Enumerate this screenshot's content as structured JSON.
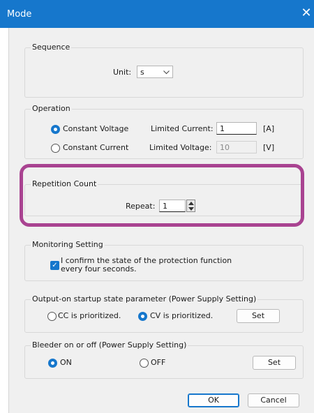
{
  "window": {
    "title": "Mode",
    "close_glyph": "✕"
  },
  "sequence": {
    "legend": "Sequence",
    "unit_label": "Unit:",
    "unit_value": "s"
  },
  "operation": {
    "legend": "Operation",
    "constant_voltage": "Constant Voltage",
    "constant_current": "Constant Current",
    "limited_current_label": "Limited Current:",
    "limited_current_value": "1",
    "limited_current_unit": "[A]",
    "limited_voltage_label": "Limited Voltage:",
    "limited_voltage_value": "10",
    "limited_voltage_unit": "[V]"
  },
  "repetition": {
    "legend": "Repetition Count",
    "repeat_label": "Repeat:",
    "repeat_value": "1"
  },
  "monitoring": {
    "legend": "Monitoring Setting",
    "confirm_line1": "I confirm the state of the protection function",
    "confirm_line2": "every four seconds."
  },
  "output_on": {
    "legend": "Output-on startup state parameter (Power Supply Setting)",
    "cc_label": "CC is prioritized.",
    "cv_label": "CV is prioritized.",
    "set_label": "Set"
  },
  "bleeder": {
    "legend": "Bleeder on or off (Power Supply Setting)",
    "on_label": "ON",
    "off_label": "OFF",
    "set_label": "Set"
  },
  "footer": {
    "ok_label": "OK",
    "cancel_label": "Cancel"
  },
  "colors": {
    "titlebar": "#1677cc",
    "accent": "#1677cc",
    "highlight": "#a94391"
  }
}
